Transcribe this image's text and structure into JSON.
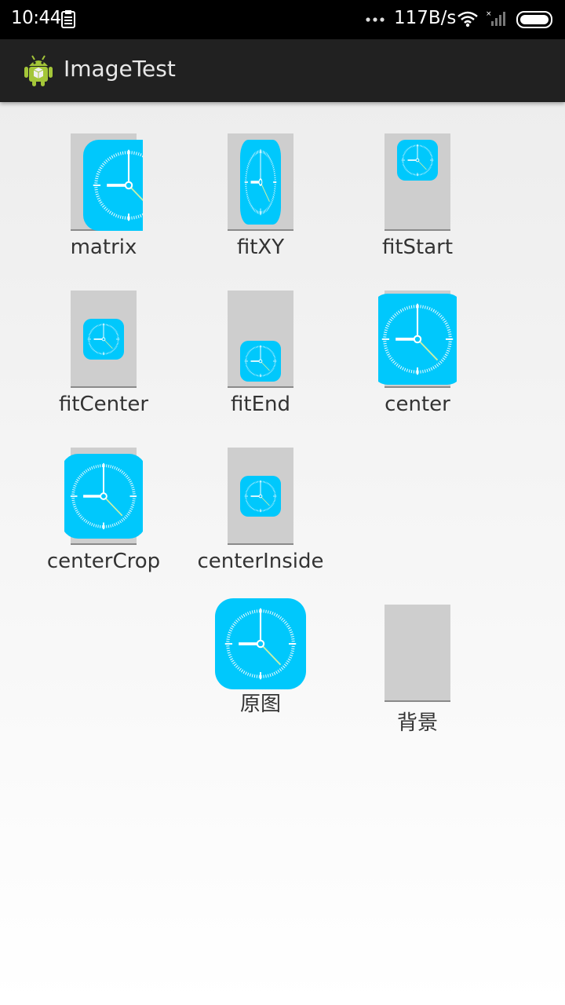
{
  "status_bar": {
    "time": "10:44",
    "net_speed": "117B/s",
    "icons": [
      "clipboard-icon",
      "more-dots-icon",
      "wifi-icon",
      "signal-icon",
      "battery-icon"
    ]
  },
  "action_bar": {
    "title": "ImageTest",
    "icon": "android-icon"
  },
  "grid": {
    "items": [
      {
        "label": "matrix"
      },
      {
        "label": "fitXY"
      },
      {
        "label": "fitStart"
      },
      {
        "label": "fitCenter"
      },
      {
        "label": "fitEnd"
      },
      {
        "label": "center"
      },
      {
        "label": "centerCrop"
      },
      {
        "label": "centerInside"
      },
      {
        "label": "原图"
      },
      {
        "label": "背景"
      }
    ]
  },
  "colors": {
    "clock_bg": "#00c8fc",
    "frame_bg": "#cecece",
    "action_bar": "#212121"
  }
}
